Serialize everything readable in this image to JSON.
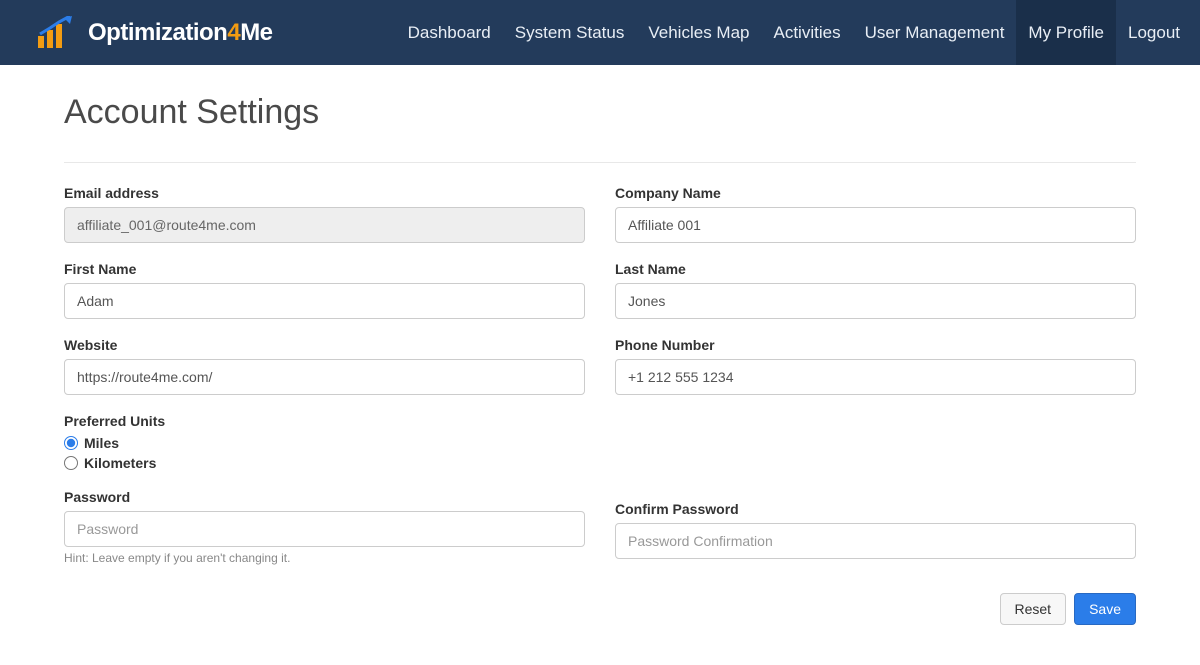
{
  "brand": {
    "name_part1": "Optimization",
    "name_part2": "4",
    "name_part3": "Me"
  },
  "nav": {
    "items": [
      {
        "label": "Dashboard",
        "active": false
      },
      {
        "label": "System Status",
        "active": false
      },
      {
        "label": "Vehicles Map",
        "active": false
      },
      {
        "label": "Activities",
        "active": false
      },
      {
        "label": "User Management",
        "active": false
      },
      {
        "label": "My Profile",
        "active": true
      },
      {
        "label": "Logout",
        "active": false
      }
    ]
  },
  "page": {
    "title": "Account Settings"
  },
  "form": {
    "email": {
      "label": "Email address",
      "value": "affiliate_001@route4me.com",
      "disabled": true
    },
    "company": {
      "label": "Company Name",
      "value": "Affiliate 001"
    },
    "first_name": {
      "label": "First Name",
      "value": "Adam"
    },
    "last_name": {
      "label": "Last Name",
      "value": "Jones"
    },
    "website": {
      "label": "Website",
      "value": "https://route4me.com/"
    },
    "phone": {
      "label": "Phone Number",
      "value": "+1 212 555 1234"
    },
    "units": {
      "label": "Preferred Units",
      "options": [
        {
          "label": "Miles",
          "checked": true
        },
        {
          "label": "Kilometers",
          "checked": false
        }
      ]
    },
    "password": {
      "label": "Password",
      "placeholder": "Password",
      "hint": "Hint: Leave empty if you aren't changing it."
    },
    "confirm_password": {
      "label": "Confirm Password",
      "placeholder": "Password Confirmation"
    }
  },
  "actions": {
    "reset": "Reset",
    "save": "Save"
  },
  "colors": {
    "navbar": "#233b5b",
    "accent": "#f39c12",
    "primary": "#2b7de9"
  }
}
